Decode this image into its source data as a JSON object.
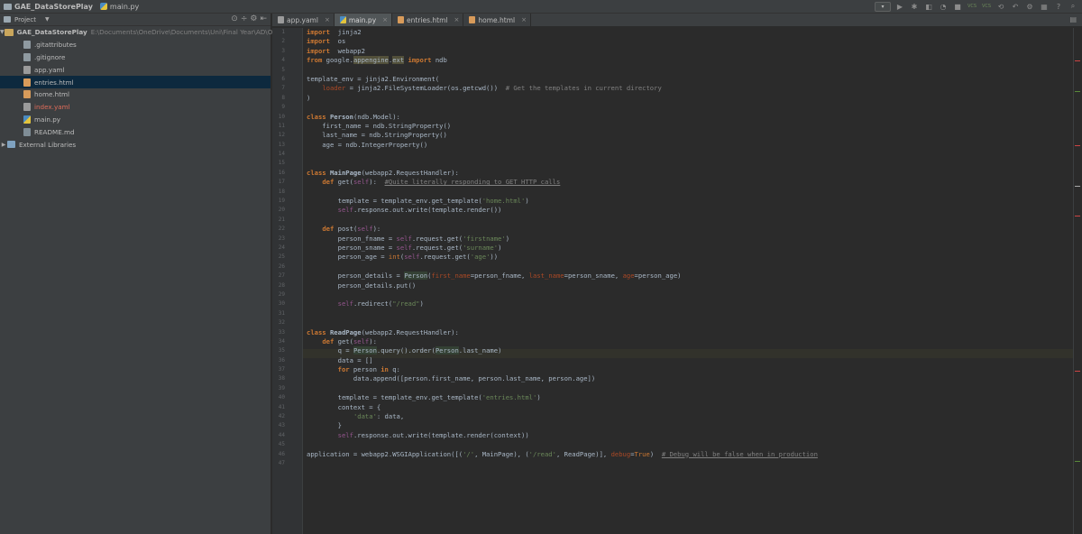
{
  "topbar": {
    "project_name": "GAE_DataStorePlay",
    "file_name": "main.py",
    "vcs_label_1": "VCS",
    "vcs_label_2": "VCS"
  },
  "project_panel": {
    "title": "Project",
    "root": {
      "name": "GAE_DataStorePlay",
      "path": "E:\\Documents\\OneDrive\\Documents\\Uni\\Final Year\\AD\\Othe"
    },
    "files": [
      {
        "name": ".gitattributes",
        "icon": "text-file-icon",
        "status": "normal"
      },
      {
        "name": ".gitignore",
        "icon": "text-file-icon",
        "status": "normal"
      },
      {
        "name": "app.yaml",
        "icon": "yaml-file-icon",
        "status": "normal"
      },
      {
        "name": "entries.html",
        "icon": "html-file-icon",
        "status": "normal"
      },
      {
        "name": "home.html",
        "icon": "html-file-icon",
        "status": "normal"
      },
      {
        "name": "index.yaml",
        "icon": "yaml-file-icon",
        "status": "modified"
      },
      {
        "name": "main.py",
        "icon": "python-file-icon",
        "status": "normal"
      },
      {
        "name": "README.md",
        "icon": "markdown-file-icon",
        "status": "normal"
      }
    ],
    "external": "External Libraries",
    "selected_file": "entries.html"
  },
  "tabs": [
    {
      "label": "app.yaml",
      "icon": "yaml-file-icon"
    },
    {
      "label": "main.py",
      "icon": "python-file-icon",
      "active": true
    },
    {
      "label": "entries.html",
      "icon": "html-file-icon"
    },
    {
      "label": "home.html",
      "icon": "html-file-icon"
    }
  ],
  "editor": {
    "current_line": 35,
    "line_numbers": [
      "1",
      "2",
      "3",
      "4",
      "5",
      "6",
      "7",
      "8",
      "9",
      "10",
      "11",
      "12",
      "13",
      "14",
      "15",
      "16",
      "17",
      "18",
      "19",
      "20",
      "21",
      "22",
      "23",
      "24",
      "25",
      "26",
      "27",
      "28",
      "29",
      "30",
      "31",
      "32",
      "33",
      "34",
      "35",
      "36",
      "37",
      "38",
      "39",
      "40",
      "41",
      "42",
      "43",
      "44",
      "45",
      "46",
      "47"
    ],
    "lines": [
      [
        [
          "kw",
          "import"
        ],
        [
          "",
          "  jinja2"
        ]
      ],
      [
        [
          "kw",
          "import"
        ],
        [
          "",
          "  os"
        ]
      ],
      [
        [
          "kw",
          "import"
        ],
        [
          "",
          "  webapp2"
        ]
      ],
      [
        [
          "kw",
          "from"
        ],
        [
          "",
          " google."
        ],
        [
          "hly",
          "appengine"
        ],
        [
          "",
          "."
        ],
        [
          "hly",
          "ext"
        ],
        [
          "",
          ""
        ],
        [
          "kw",
          " import"
        ],
        [
          "",
          " ndb"
        ]
      ],
      [],
      [
        [
          "",
          "template_env = jinja2.Environment("
        ]
      ],
      [
        [
          "",
          "    "
        ],
        [
          "param",
          "loader"
        ],
        [
          "",
          " = jinja2.FileSystemLoader(os.getcwd())  "
        ],
        [
          "cmt",
          "# Get the templates in current directory"
        ]
      ],
      [
        [
          "",
          ")"
        ]
      ],
      [],
      [
        [
          "kw",
          "class"
        ],
        [
          "",
          " "
        ],
        [
          "cls",
          "Person"
        ],
        [
          "",
          "(ndb.Model):"
        ]
      ],
      [
        [
          "",
          "    first_name = ndb.StringProperty()"
        ]
      ],
      [
        [
          "",
          "    last_name = ndb.StringProperty()"
        ]
      ],
      [
        [
          "",
          "    age = ndb.IntegerProperty()"
        ]
      ],
      [],
      [],
      [
        [
          "kw",
          "class"
        ],
        [
          "",
          " "
        ],
        [
          "cls",
          "MainPage"
        ],
        [
          "",
          "(webapp2.RequestHandler):"
        ]
      ],
      [
        [
          "",
          "    "
        ],
        [
          "kw",
          "def"
        ],
        [
          "",
          " "
        ],
        [
          "fn",
          "get"
        ],
        [
          "",
          "("
        ],
        [
          "self",
          "self"
        ],
        [
          "",
          "):  "
        ],
        [
          "cmtu",
          "#Quite literally responding to GET HTTP calls"
        ]
      ],
      [],
      [
        [
          "",
          "        template = template_env.get_template("
        ],
        [
          "str",
          "'home.html'"
        ],
        [
          "",
          ")"
        ]
      ],
      [
        [
          "",
          "        "
        ],
        [
          "self",
          "self"
        ],
        [
          "",
          ".response.out.write(template.render())"
        ]
      ],
      [],
      [
        [
          "",
          "    "
        ],
        [
          "kw",
          "def"
        ],
        [
          "",
          " "
        ],
        [
          "fn",
          "post"
        ],
        [
          "",
          "("
        ],
        [
          "self",
          "self"
        ],
        [
          "",
          "):"
        ]
      ],
      [
        [
          "",
          "        person_fname = "
        ],
        [
          "self",
          "self"
        ],
        [
          "",
          ".request.get("
        ],
        [
          "str",
          "'firstname'"
        ],
        [
          "",
          ")"
        ]
      ],
      [
        [
          "",
          "        person_sname = "
        ],
        [
          "self",
          "self"
        ],
        [
          "",
          ".request.get("
        ],
        [
          "str",
          "'surname'"
        ],
        [
          "",
          ")"
        ]
      ],
      [
        [
          "",
          "        person_age = "
        ],
        [
          "kwn",
          "int"
        ],
        [
          "",
          "("
        ],
        [
          "self",
          "self"
        ],
        [
          "",
          ".request.get("
        ],
        [
          "str",
          "'age'"
        ],
        [
          "",
          "))"
        ]
      ],
      [],
      [
        [
          "",
          "        person_details = "
        ],
        [
          "hl",
          "Person"
        ],
        [
          "",
          "("
        ],
        [
          "param",
          "first_name"
        ],
        [
          "",
          "=person_fname, "
        ],
        [
          "param",
          "last_name"
        ],
        [
          "",
          "=person_sname, "
        ],
        [
          "param",
          "age"
        ],
        [
          "",
          "=person_age)"
        ]
      ],
      [
        [
          "",
          "        person_details.put()"
        ]
      ],
      [],
      [
        [
          "",
          "        "
        ],
        [
          "self",
          "self"
        ],
        [
          "",
          ".redirect("
        ],
        [
          "str",
          "\"/read\""
        ],
        [
          "",
          ")"
        ]
      ],
      [],
      [],
      [
        [
          "kw",
          "class"
        ],
        [
          "",
          " "
        ],
        [
          "cls",
          "ReadPage"
        ],
        [
          "",
          "(webapp2.RequestHandler):"
        ]
      ],
      [
        [
          "",
          "    "
        ],
        [
          "kw",
          "def"
        ],
        [
          "",
          " "
        ],
        [
          "fn",
          "get"
        ],
        [
          "",
          "("
        ],
        [
          "self",
          "self"
        ],
        [
          "",
          "):"
        ]
      ],
      [
        [
          "",
          "        q = "
        ],
        [
          "hl",
          "Person"
        ],
        [
          "",
          ".query().order("
        ],
        [
          "hl",
          "Person"
        ],
        [
          "",
          ".last_name)"
        ]
      ],
      [
        [
          "",
          "        data = []"
        ]
      ],
      [
        [
          "",
          "        "
        ],
        [
          "kw",
          "for"
        ],
        [
          "",
          " person "
        ],
        [
          "kw",
          "in"
        ],
        [
          "",
          " q:"
        ]
      ],
      [
        [
          "",
          "            data.append([person.first_name, person.last_name, person.age])"
        ]
      ],
      [],
      [
        [
          "",
          "        template = template_env.get_template("
        ],
        [
          "str",
          "'entries.html'"
        ],
        [
          "",
          ")"
        ]
      ],
      [
        [
          "",
          "        context = {"
        ]
      ],
      [
        [
          "",
          "            "
        ],
        [
          "str",
          "'data'"
        ],
        [
          "",
          ": data,"
        ]
      ],
      [
        [
          "",
          "        }"
        ]
      ],
      [
        [
          "",
          "        "
        ],
        [
          "self",
          "self"
        ],
        [
          "",
          ".response.out.write(template.render(context))"
        ]
      ],
      [],
      [
        [
          "",
          "application = webapp2.WSGIApplication([("
        ],
        [
          "str",
          "'/'"
        ],
        [
          "",
          ", MainPage), ("
        ],
        [
          "str",
          "'/read'"
        ],
        [
          "",
          ", ReadPage)], "
        ],
        [
          "param",
          "debug"
        ],
        [
          "",
          "="
        ],
        [
          "kwn",
          "True"
        ],
        [
          "",
          ")  "
        ],
        [
          "cmtu",
          "# Debug will be false when in production"
        ]
      ],
      []
    ]
  },
  "colors": {
    "background": "#2b2b2b",
    "panel": "#3c3f41",
    "keyword": "#cc7832",
    "string": "#6a8759",
    "comment": "#808080",
    "self": "#94558d",
    "selection": "#0d293e"
  }
}
